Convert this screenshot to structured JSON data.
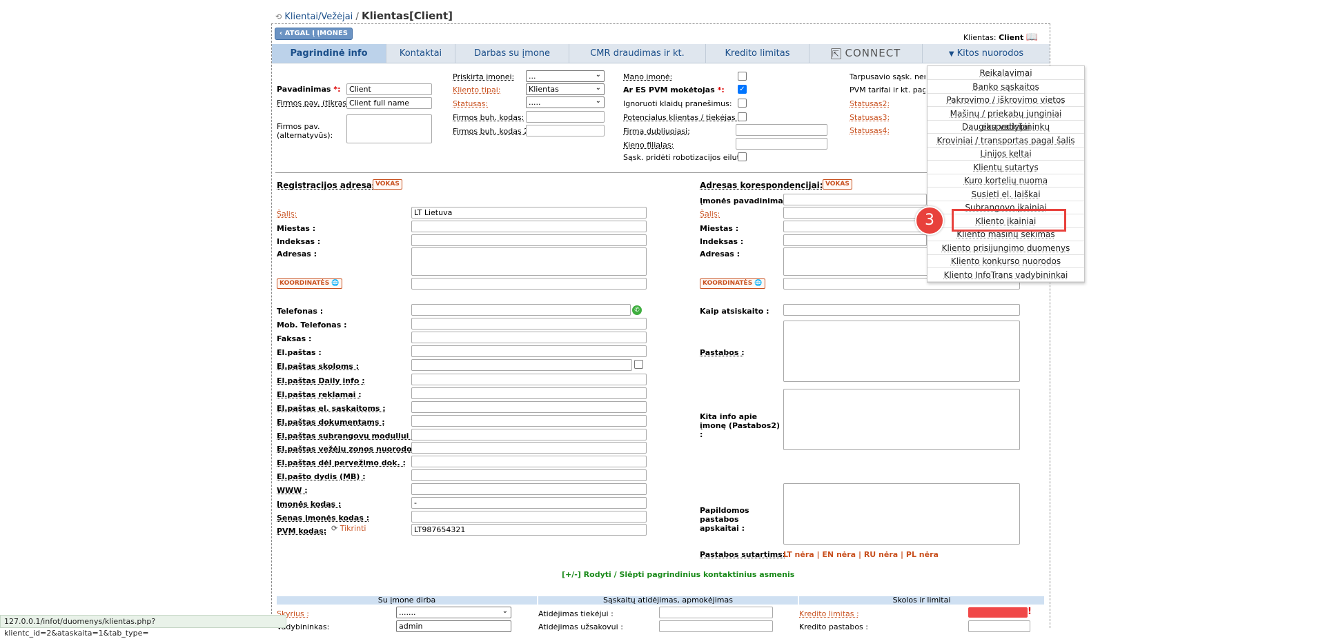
{
  "breadcrumb": {
    "link": "Klientai/Vežėjai",
    "sep": "/",
    "current": "Klientas[Client]"
  },
  "back_button": "ATGAL Į ĮMONES",
  "client_label": {
    "label": "Klientas:",
    "value": "Client"
  },
  "tabs": [
    "Pagrindinė info",
    "Kontaktai",
    "Darbas su įmone",
    "CMR draudimas ir kt.",
    "Kredito limitas",
    "CONNECT",
    "Kitos nuorodos"
  ],
  "dropdown_items": [
    "Reikalavimai",
    "Banko sąskaitos",
    "Pakrovimo / iškrovimo vietos",
    "Mašinų / priekabų junginiai ekspedicijai",
    "Daugiau vadybininkų",
    "Kroviniai / transportas pagal šalis",
    "Linijos keltai",
    "Klientų sutartys",
    "Kuro kortelių nuoma",
    "Susieti el. laiškai",
    "Subrangovo įkainiai",
    "Kliento įkainiai",
    "Kliento mašinų sekimas",
    "Kliento prisijungimo duomenys",
    "Kliento konkurso nuorodos",
    "Kliento InfoTrans vadybininkai"
  ],
  "step_badge": "3",
  "top_form": {
    "pavadinimas": {
      "label": "Pavadinimas",
      "req": "*:",
      "value": "Client"
    },
    "firmos_pav": {
      "label": "Firmos pav. (tikras):",
      "value": "Client full name"
    },
    "firmos_alt": "Firmos pav. (alternatyvūs):",
    "priskirta": {
      "label": "Priskirta įmonei:",
      "value": "..."
    },
    "kliento_tipai": {
      "label": "Kliento tipai:",
      "value": "Klientas"
    },
    "statusas": {
      "label": "Statusas:",
      "value": "....."
    },
    "buh_kodas": "Firmos buh. kodas:",
    "buh_kodas2": "Firmos buh. kodas 2:",
    "mano_imone": "Mano įmonė:",
    "es_pvm": {
      "label": "Ar ES PVM mokėtojas",
      "req": "*:"
    },
    "ignoruoti": "Ignoruoti klaidų pranešimus:",
    "potencialus": "Potencialus klientas / tiekėjas :",
    "firma_dubl": "Firma dubliuojasi:",
    "kieno_filialas": "Kieno filialas:",
    "sask_robot": "Sąsk. pridėti robotizacijos eilutę:",
    "tarpusavio": "Tarpusavio sąsk. nerašo",
    "pvm_tarifai": "PVM tarifai ir kt. pagal",
    "statusas2": "Statusas2:",
    "statusas3": "Statusas3:",
    "statusas4": "Statusas4:"
  },
  "reg_address": {
    "title": "Registracijos adresas:",
    "vokas": "VOKAS",
    "salis": {
      "label": "Šalis:",
      "value": "LT Lietuva"
    },
    "miestas": "Miestas :",
    "indeksas": "Indeksas :",
    "adresas": "Adresas :",
    "koord": "KOORDINATĖS"
  },
  "corr_address": {
    "title": "Adresas korespondencijai:",
    "vokas": "VOKAS",
    "imones_pav": "Įmonės pavadinimas :",
    "salis": "Šalis:",
    "miestas": "Miestas :",
    "indeksas": "Indeksas :",
    "adresas": "Adresas :",
    "koord": "KOORDINATĖS"
  },
  "contacts": [
    {
      "label": "Telefonas :",
      "value": ""
    },
    {
      "label": "Mob. Telefonas :",
      "value": ""
    },
    {
      "label": "Faksas :",
      "value": ""
    },
    {
      "label": "El.paštas :",
      "value": ""
    },
    {
      "label": "El.paštas skoloms :",
      "value": ""
    },
    {
      "label": "El.paštas Daily info :",
      "value": ""
    },
    {
      "label": "El.paštas reklamai :",
      "value": ""
    },
    {
      "label": "El.paštas el. sąskaitoms :",
      "value": ""
    },
    {
      "label": "El.paštas dokumentams :",
      "value": ""
    },
    {
      "label": "El.paštas subrangovų moduliui :",
      "value": ""
    },
    {
      "label": "El.paštas vežėjų zonos nuorodoms :",
      "value": ""
    },
    {
      "label": "El.paštas dėl pervežimo dok. :",
      "value": ""
    },
    {
      "label": "El.pašto dydis (MB) :",
      "value": ""
    },
    {
      "label": "WWW :",
      "value": ""
    },
    {
      "label": "Įmonės kodas :",
      "value": "-"
    },
    {
      "label": "Senas įmonės kodas :",
      "value": ""
    },
    {
      "label": "PVM kodas:",
      "value": "LT987654321"
    }
  ],
  "tikrinti": "Tikrinti",
  "right_fields": {
    "kaip": "Kaip atsiskaito :",
    "pastabos": "Pastabos :",
    "kita_info": "Kita info apie įmonę (Pastabos2) :",
    "papildomos": "Papildomos pastabos apskaitai :",
    "sutartims": "Pastabos sutartims:",
    "sutartys_links": [
      "LT nėra",
      "EN nėra",
      "RU nėra",
      "PL nėra"
    ],
    "sep": "|"
  },
  "toggle_contacts": "[+/-] Rodyti / Slėpti pagrindinius kontaktinius asmenis",
  "bottom": {
    "sect1": "Su įmone dirba",
    "sect2": "Sąskaitų atidėjimas, apmokėjimas",
    "sect3": "Skolos ir limitai",
    "skyrius": {
      "label": "Skyrius :",
      "value": "......."
    },
    "vadybininkas": {
      "label": "Vadybininkas:",
      "value": "admin"
    },
    "atid_tiek": "Atidėjimas tiekėjui :",
    "atid_uzs": "Atidėjimas užsakovui :",
    "kredito_limitas": "Kredito limitas :",
    "kredito_pastabos": "Kredito pastabos :",
    "excl": "!"
  },
  "status_url": "127.0.0.1/infot/duomenys/klientas.php?klientc_id=2&ataskaita=1&tab_type=",
  "colors": {
    "accent": "#1b4f8a",
    "orange": "#c8501e",
    "badge": "#e8413c",
    "highlight": "#e8413c"
  }
}
